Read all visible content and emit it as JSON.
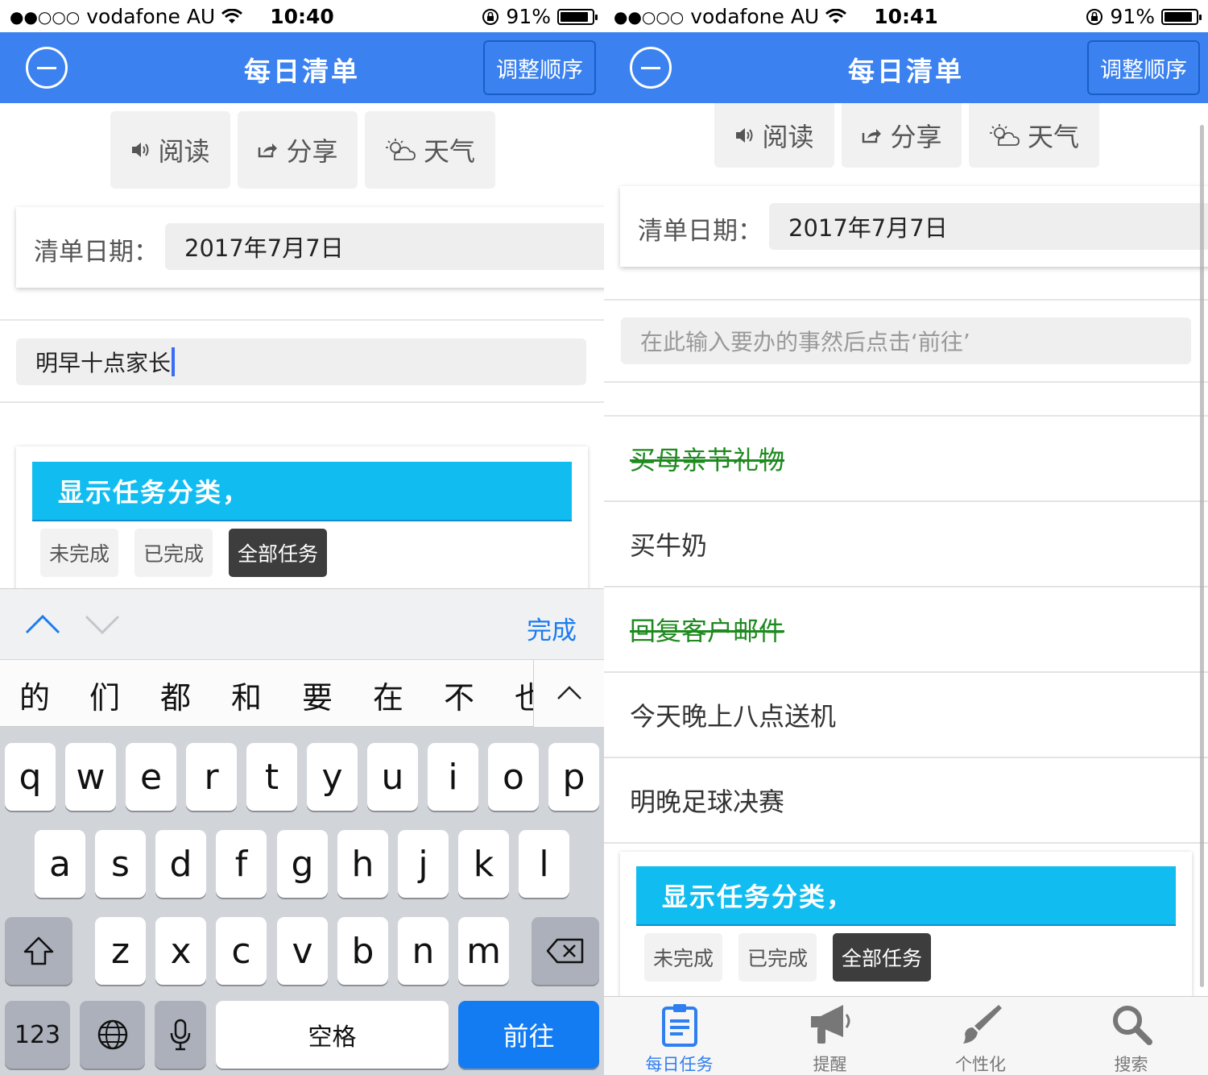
{
  "left": {
    "status": {
      "carrier": "vodafone AU",
      "time": "10:40",
      "battery": "91%"
    },
    "nav": {
      "title": "每日清单",
      "reorder": "调整顺序"
    },
    "actions": {
      "read": "阅读",
      "share": "分享",
      "weather": "天气"
    },
    "date": {
      "label": "清单日期：",
      "value": "2017年7月7日"
    },
    "input": {
      "value": "明早十点家长"
    },
    "category": {
      "header": "显示任务分类，",
      "buttons": [
        "未完成",
        "已完成",
        "全部任务"
      ],
      "active": "全部任务"
    },
    "keyboard": {
      "done": "完成",
      "candidates": [
        "的",
        "们",
        "都",
        "和",
        "要",
        "在",
        "不",
        "也"
      ],
      "row1": [
        "q",
        "w",
        "e",
        "r",
        "t",
        "y",
        "u",
        "i",
        "o",
        "p"
      ],
      "row2": [
        "a",
        "s",
        "d",
        "f",
        "g",
        "h",
        "j",
        "k",
        "l"
      ],
      "row3": [
        "z",
        "x",
        "c",
        "v",
        "b",
        "n",
        "m"
      ],
      "numbers": "123",
      "space": "空格",
      "go": "前往"
    }
  },
  "right": {
    "status": {
      "carrier": "vodafone AU",
      "time": "10:41",
      "battery": "91%"
    },
    "nav": {
      "title": "每日清单",
      "reorder": "调整顺序"
    },
    "actions": {
      "read": "阅读",
      "share": "分享",
      "weather": "天气"
    },
    "date": {
      "label": "清单日期：",
      "value": "2017年7月7日"
    },
    "input": {
      "placeholder": "在此输入要办的事然后点击‘前往’"
    },
    "tasks": [
      {
        "text": "买母亲节礼物",
        "done": true
      },
      {
        "text": "买牛奶",
        "done": false
      },
      {
        "text": "回复客户邮件",
        "done": true
      },
      {
        "text": "今天晚上八点送机",
        "done": false
      },
      {
        "text": "明晚足球决赛",
        "done": false
      }
    ],
    "category": {
      "header": "显示任务分类，",
      "buttons": [
        "未完成",
        "已完成",
        "全部任务"
      ],
      "active": "全部任务"
    },
    "tabs": [
      {
        "label": "每日任务",
        "icon": "clipboard-icon",
        "active": true
      },
      {
        "label": "提醒",
        "icon": "megaphone-icon",
        "active": false
      },
      {
        "label": "个性化",
        "icon": "paintbrush-icon",
        "active": false
      },
      {
        "label": "搜索",
        "icon": "search-icon",
        "active": false
      }
    ]
  },
  "colors": {
    "nav_blue": "#3b82f0",
    "category_header": "#11bdf0",
    "done_green": "#1f8a1f",
    "active_tab": "#2f7ff0",
    "go_key": "#137cf2"
  }
}
